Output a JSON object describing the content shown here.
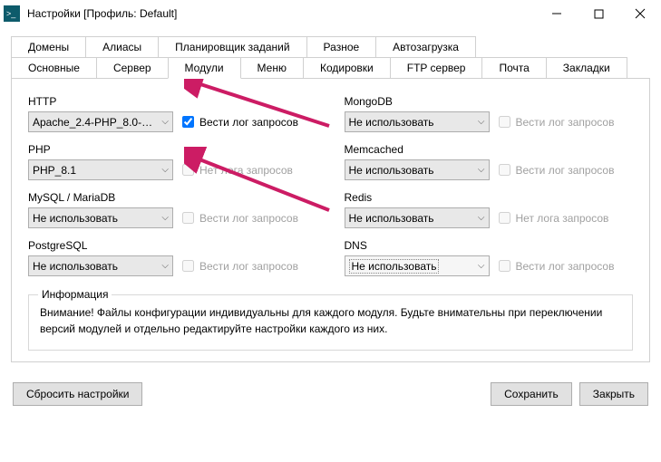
{
  "window": {
    "title": "Настройки [Профиль: Default]"
  },
  "tabs": {
    "row1": [
      "Домены",
      "Алиасы",
      "Планировщик заданий",
      "Разное",
      "Автозагрузка"
    ],
    "row2": [
      "Основные",
      "Сервер",
      "Модули",
      "Меню",
      "Кодировки",
      "FTP сервер",
      "Почта",
      "Закладки"
    ],
    "active": "Модули"
  },
  "modules": {
    "http": {
      "label": "HTTP",
      "value": "Apache_2.4-PHP_8.0-…",
      "log_checked": true,
      "log_label": "Вести лог запросов",
      "log_disabled": false
    },
    "php": {
      "label": "PHP",
      "value": "PHP_8.1",
      "log_checked": false,
      "log_label": "Нет лога запросов",
      "log_disabled": true
    },
    "mysql": {
      "label": "MySQL / MariaDB",
      "value": "Не использовать",
      "log_checked": false,
      "log_label": "Вести лог запросов",
      "log_disabled": true
    },
    "postgres": {
      "label": "PostgreSQL",
      "value": "Не использовать",
      "log_checked": false,
      "log_label": "Вести лог запросов",
      "log_disabled": true
    },
    "mongodb": {
      "label": "MongoDB",
      "value": "Не использовать",
      "log_checked": false,
      "log_label": "Вести лог запросов",
      "log_disabled": true
    },
    "memcached": {
      "label": "Memcached",
      "value": "Не использовать",
      "log_checked": false,
      "log_label": "Вести лог запросов",
      "log_disabled": true
    },
    "redis": {
      "label": "Redis",
      "value": "Не использовать",
      "log_checked": false,
      "log_label": "Нет лога запросов",
      "log_disabled": true
    },
    "dns": {
      "label": "DNS",
      "value": "Не использовать",
      "log_checked": false,
      "log_label": "Вести лог запросов",
      "log_disabled": true
    }
  },
  "info": {
    "legend": "Информация",
    "text": "Внимание! Файлы конфигурации индивидуальны для каждого модуля. Будьте внимательны при переключении версий модулей и отдельно редактируйте настройки каждого из них."
  },
  "buttons": {
    "reset": "Сбросить настройки",
    "save": "Сохранить",
    "close": "Закрыть"
  }
}
